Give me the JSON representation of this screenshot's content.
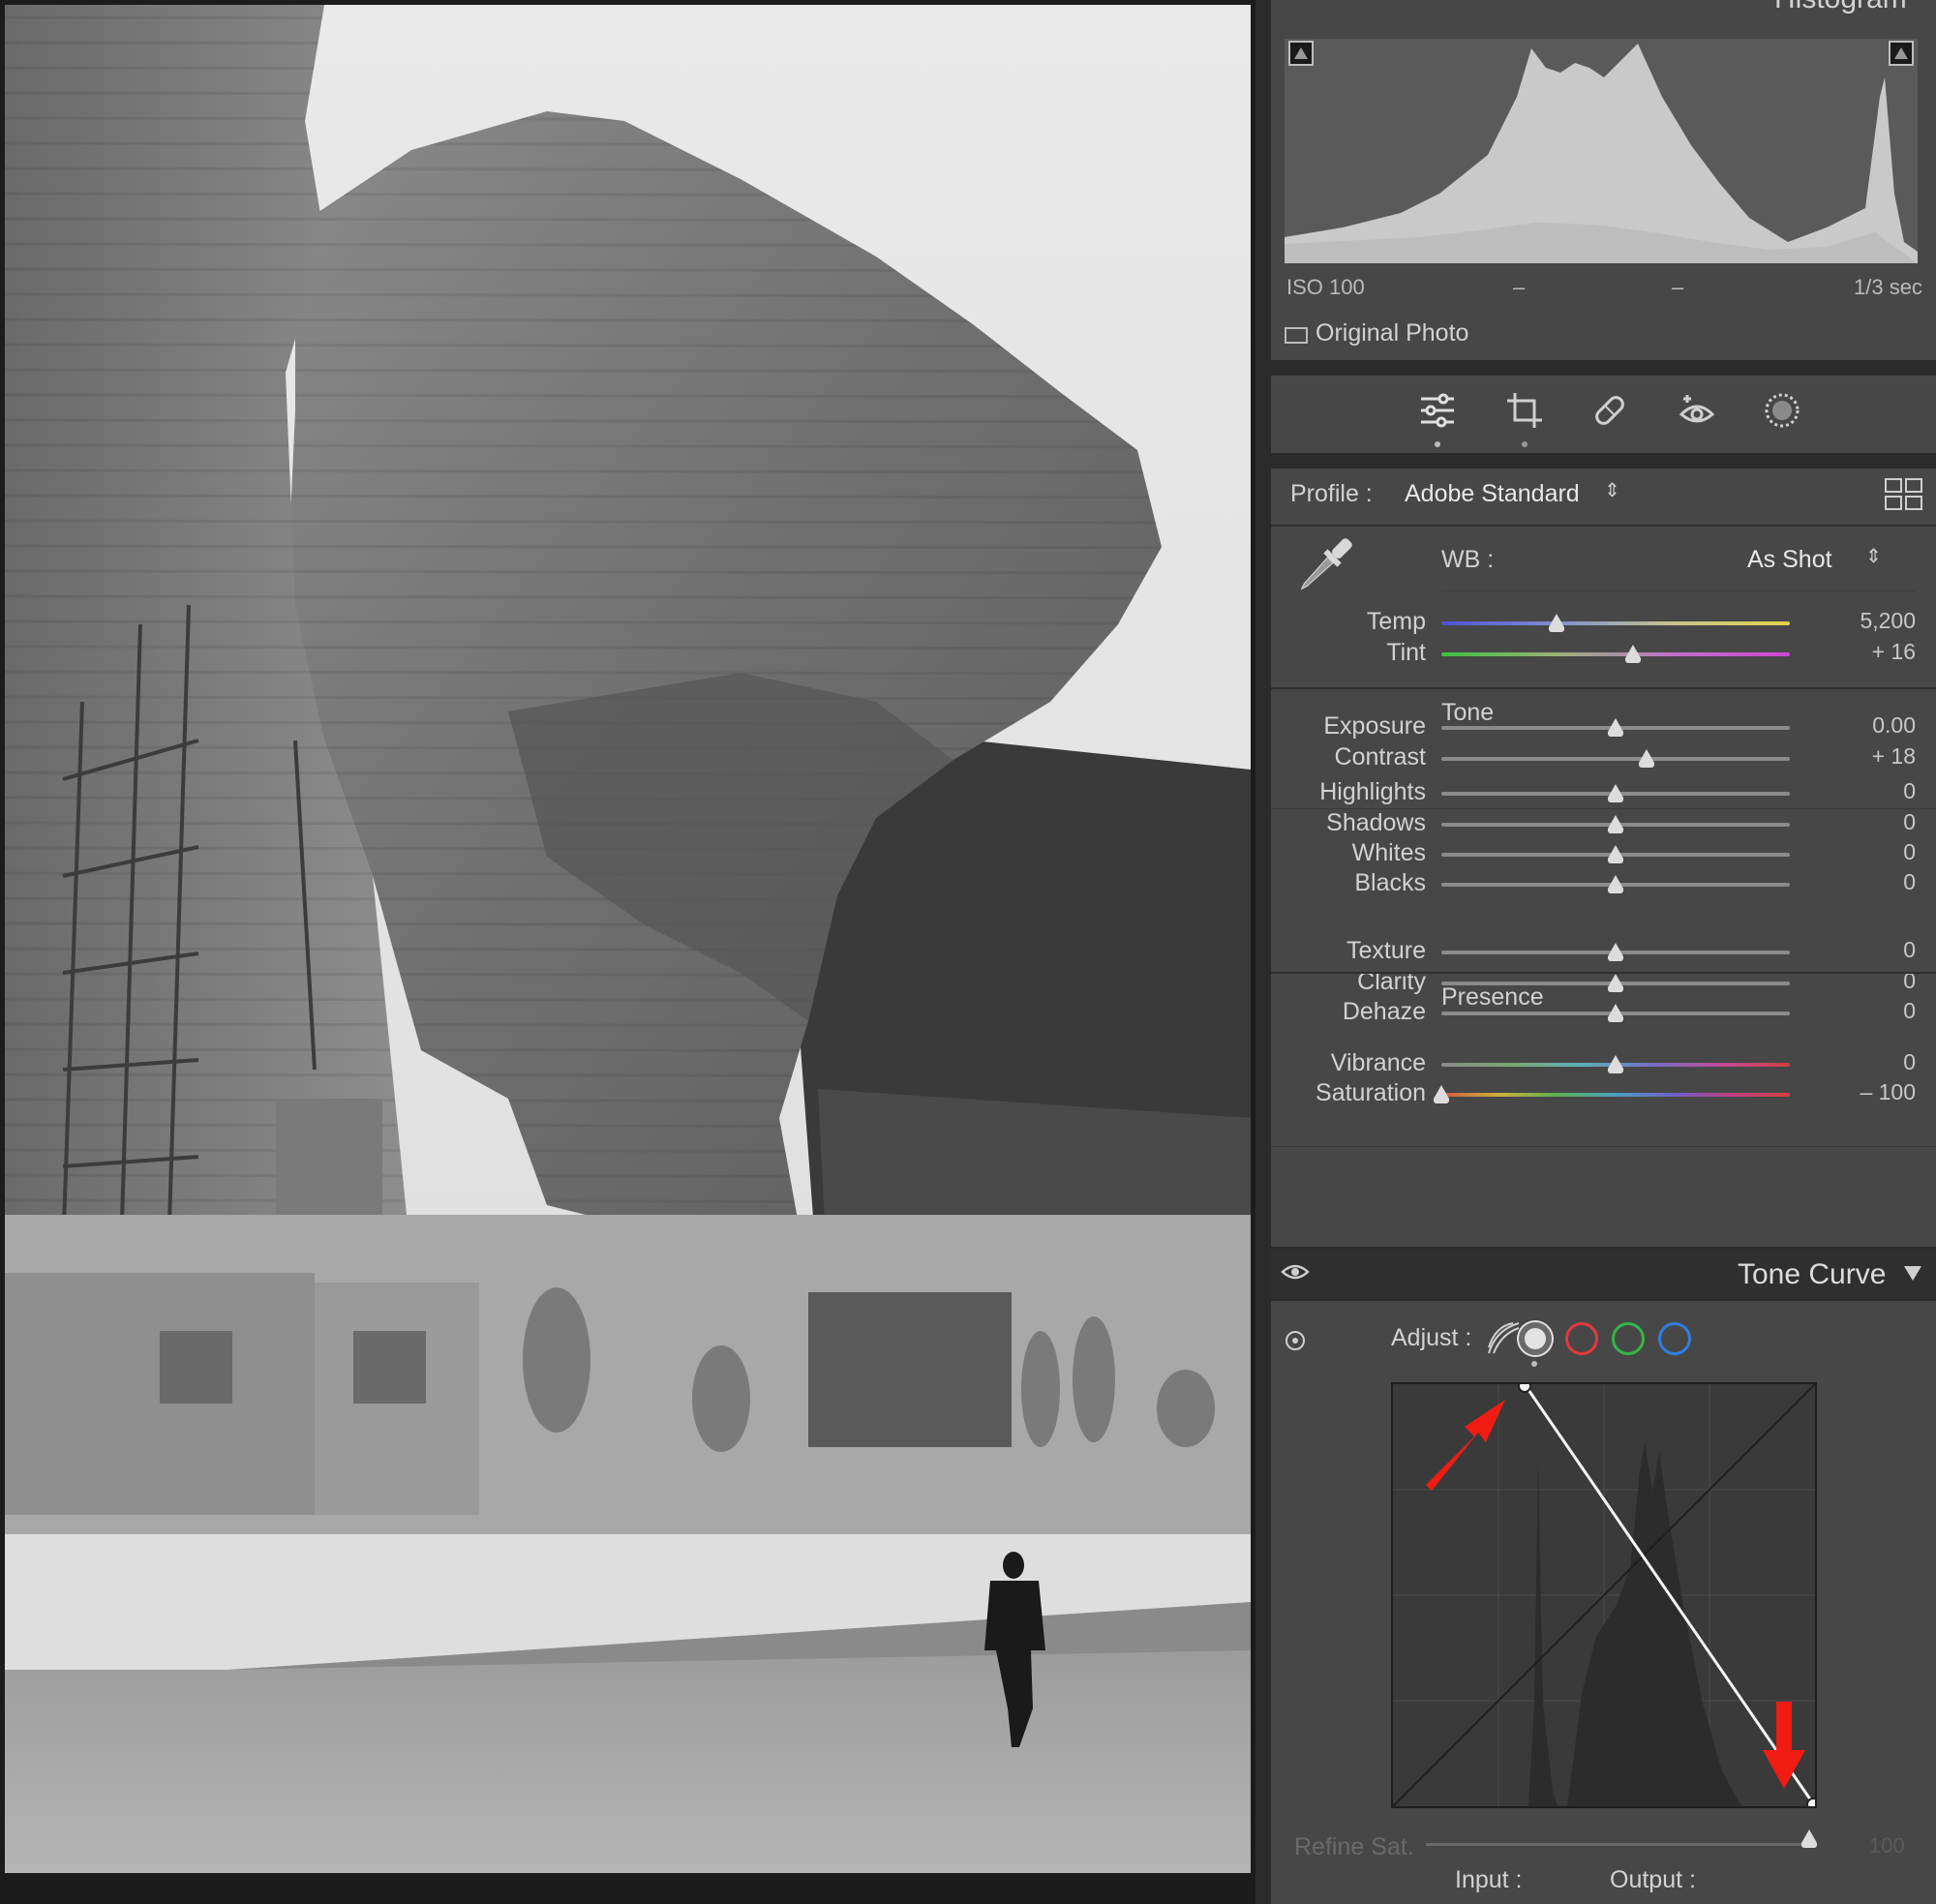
{
  "histogram": {
    "title": "Histogram",
    "iso": "ISO 100",
    "dash1": "–",
    "dash2": "–",
    "shutter": "1/3 sec",
    "original_photo_label": "Original Photo"
  },
  "tools": [
    "edit-sliders-icon",
    "crop-icon",
    "healing-icon",
    "red-eye-icon",
    "masking-icon"
  ],
  "profile": {
    "label": "Profile :",
    "value": "Adobe Standard"
  },
  "wb": {
    "label": "WB :",
    "value": "As Shot"
  },
  "sliders": {
    "temp": {
      "label": "Temp",
      "value": "5,200",
      "pos": 0.33
    },
    "tint": {
      "label": "Tint",
      "value": "+ 16",
      "pos": 0.55
    },
    "tone_title": "Tone",
    "exposure": {
      "label": "Exposure",
      "value": "0.00",
      "pos": 0.5
    },
    "contrast": {
      "label": "Contrast",
      "value": "+ 18",
      "pos": 0.59
    },
    "highlights": {
      "label": "Highlights",
      "value": "0",
      "pos": 0.5
    },
    "shadows": {
      "label": "Shadows",
      "value": "0",
      "pos": 0.5
    },
    "whites": {
      "label": "Whites",
      "value": "0",
      "pos": 0.5
    },
    "blacks": {
      "label": "Blacks",
      "value": "0",
      "pos": 0.5
    },
    "presence_title": "Presence",
    "texture": {
      "label": "Texture",
      "value": "0",
      "pos": 0.5
    },
    "clarity": {
      "label": "Clarity",
      "value": "0",
      "pos": 0.5
    },
    "dehaze": {
      "label": "Dehaze",
      "value": "0",
      "pos": 0.5
    },
    "vibrance": {
      "label": "Vibrance",
      "value": "0",
      "pos": 0.5
    },
    "saturation": {
      "label": "Saturation",
      "value": "– 100",
      "pos": 0.0
    }
  },
  "tone_curve": {
    "title": "Tone Curve",
    "adjust_label": "Adjust :",
    "refine_label": "Refine Sat.",
    "refine_value": "100",
    "refine_pos": 0.99,
    "input_label": "Input :",
    "output_label": "Output :",
    "channel_colors": [
      "#e3e3e3",
      "#e23a3a",
      "#35b54a",
      "#2f7fe0"
    ]
  },
  "colors": {
    "annotation_arrow": "#f01c12"
  }
}
